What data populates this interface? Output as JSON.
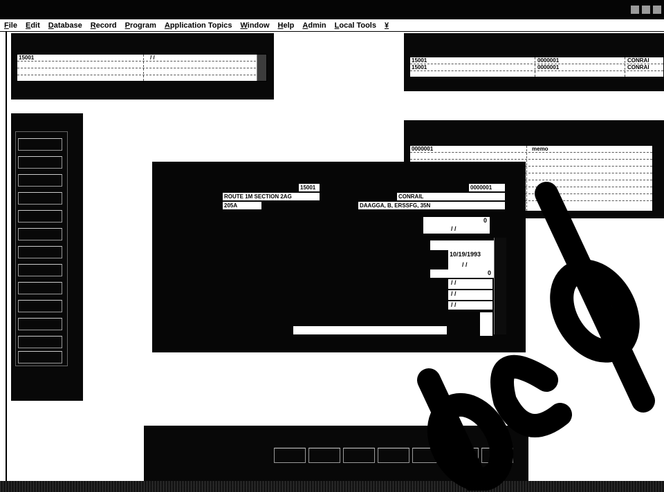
{
  "menu": [
    "File",
    "Edit",
    "Database",
    "Record",
    "Program",
    "Application Topics",
    "Window",
    "Help",
    "Admin",
    "Local Tools",
    "¥"
  ],
  "win_top_left": {
    "row1": [
      "15001",
      "/ /"
    ]
  },
  "win_top_right": {
    "rows": [
      [
        "15001",
        "0000001",
        "CONRAI"
      ],
      [
        "15001",
        "0000001",
        "CONRAI"
      ]
    ]
  },
  "win_right_mid": {
    "rows": [
      [
        "0000001",
        "memo"
      ]
    ]
  },
  "dialog": {
    "values": {
      "project_no": "15001",
      "right_no": "0000001",
      "route": "ROUTE 1M SECTION 2AG",
      "railroad": "CONRAIL",
      "parcel": "205A",
      "description": "DAAGGA, B, ERSSFG, 35N"
    },
    "fields": {
      "f1_count": "0",
      "f1_date": "/ /",
      "f2_date": "10/19/1993",
      "f2_blank": "/ /",
      "f3_count": "0",
      "f4": "/ /",
      "f5": "/ /",
      "f6": "/ /"
    }
  }
}
